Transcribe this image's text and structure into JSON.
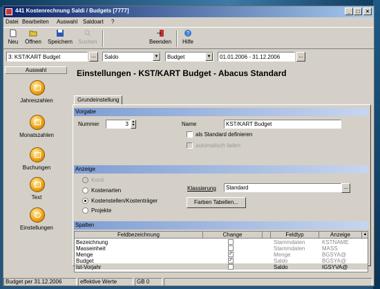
{
  "window": {
    "title": "441 Kostenrechnung Saldi / Budgets [7777]"
  },
  "menu": [
    "Datei",
    "Bearbeiten",
    "Auswahl",
    "Saldoart",
    "?"
  ],
  "toolbar": {
    "new": "Neu",
    "open": "Öffnen",
    "save": "Speichern",
    "search": "Suchen",
    "exit": "Beenden",
    "help": "Hilfe"
  },
  "filters": {
    "object": "3: KST/KART Budget",
    "type": "Saldo",
    "budget": "Budget",
    "period": "01.01.2006 - 31.12.2006"
  },
  "sidebar": {
    "title": "Auswahl",
    "items": [
      {
        "label": "Jahreszahlen"
      },
      {
        "label": "Monatszahlen"
      },
      {
        "label": "Buchungen"
      },
      {
        "label": "Text"
      },
      {
        "label": "Einstellungen"
      }
    ]
  },
  "main": {
    "title": "Einstellungen - KST/KART Budget - Abacus Standard",
    "tab": "Grundeinstellung",
    "vorgabe": {
      "section": "Vorgabe",
      "nummer_label": "Nummer",
      "nummer_value": "3",
      "name_label": "Name",
      "name_value": "KST/KART Budget",
      "standard_label": "als Standard definieren",
      "auto_label": "automatisch laden"
    },
    "anzeige": {
      "section": "Anzeige",
      "options": [
        "Konti",
        "Kostenarten",
        "Kostenstellen/Kostenträger",
        "Projekte"
      ],
      "selected": "Kostenstellen/Kostenträger",
      "klassierung_label": "Klassierung",
      "klassierung_value": "Standard",
      "farben_button": "Farben Tabellen..."
    },
    "spalten": {
      "section": "Spalten",
      "left_headers": [
        "Feldbezeichnung",
        "Change"
      ],
      "right_headers": [
        "Feldtyp",
        "Anzeige"
      ],
      "left_rows": [
        {
          "name": "Bezeichnung",
          "change": false
        },
        {
          "name": "Masseinheit",
          "change": false
        },
        {
          "name": "Menge",
          "change": true
        },
        {
          "name": "Budget",
          "change": true
        },
        {
          "name": "Ist-Vorjahr",
          "change": false
        }
      ],
      "right_rows": [
        {
          "type": "Stammdaten",
          "display": "KSTNAME"
        },
        {
          "type": "Stammdaten",
          "display": "MASS"
        },
        {
          "type": "Menge",
          "display": "BGSYA@"
        },
        {
          "type": "Saldo",
          "display": "BGSYA@"
        },
        {
          "type": "Saldo",
          "display": "IGSYVA@"
        }
      ]
    }
  },
  "status": {
    "budget": "Budget per 31.12.2006",
    "mode": "effektive Werte",
    "gb": "GB 0"
  }
}
